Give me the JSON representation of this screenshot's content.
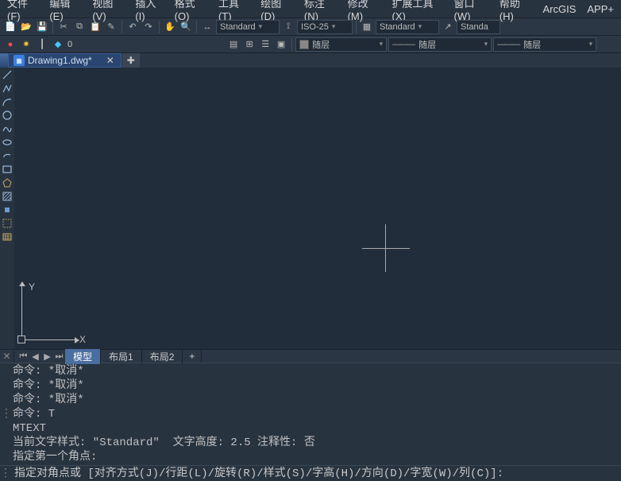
{
  "menu": [
    "文件(F)",
    "编辑(E)",
    "视图(V)",
    "插入(I)",
    "格式(O)",
    "工具(T)",
    "绘图(D)",
    "标注(N)",
    "修改(M)",
    "扩展工具(X)",
    "窗口(W)",
    "帮助(H)",
    "ArcGIS",
    "APP+"
  ],
  "toolbar1": {
    "combo_dim": "Standard",
    "combo_iso": "ISO-25",
    "combo_std2": "Standard",
    "combo_std3": "Standa"
  },
  "toolbar2": {
    "coord": "0",
    "layer": "随层",
    "line_layer": "随层",
    "ltype": "随层"
  },
  "file_tab": {
    "name": "Drawing1.dwg*",
    "icon_text": "▦"
  },
  "ucs": {
    "x": "X",
    "y": "Y"
  },
  "layout_tabs": [
    "模型",
    "布局1",
    "布局2",
    "+"
  ],
  "cmd_history": [
    "命令: *取消*",
    "命令: *取消*",
    "命令: *取消*",
    "命令: T",
    "MTEXT",
    "当前文字样式: \"Standard\"  文字高度: 2.5 注释性: 否",
    "指定第一个角点:"
  ],
  "cmd_prompt": "指定对角点或 [对齐方式(J)/行距(L)/旋转(R)/样式(S)/字高(H)/方向(D)/字宽(W)/列(C)]: ",
  "cmd_value": ""
}
